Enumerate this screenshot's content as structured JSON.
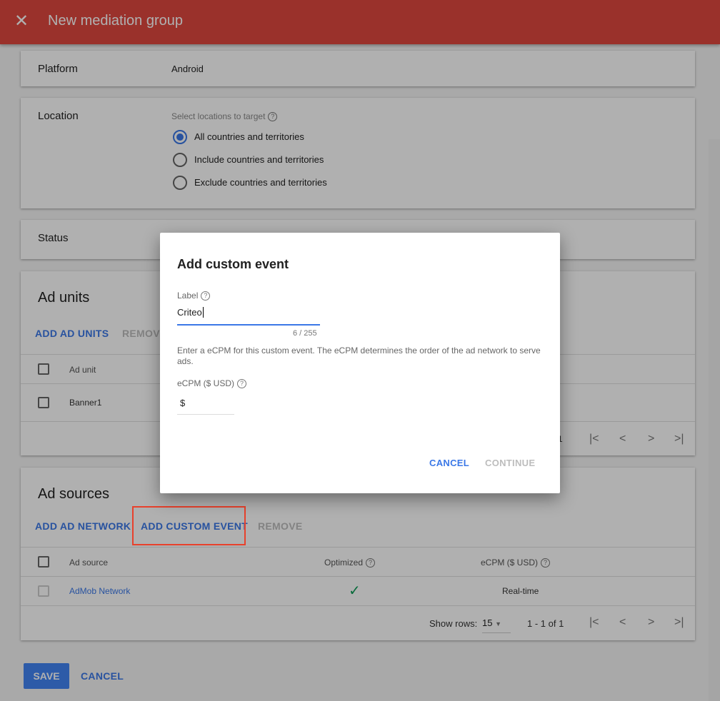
{
  "header": {
    "title": "New mediation group",
    "close_icon": "close-icon"
  },
  "platform": {
    "label": "Platform",
    "value": "Android"
  },
  "location": {
    "label": "Location",
    "hint": "Select locations to target",
    "options": [
      "All countries and territories",
      "Include countries and territories",
      "Exclude countries and territories"
    ],
    "selected": 0
  },
  "status": {
    "label": "Status"
  },
  "ad_units": {
    "title": "Ad units",
    "add_label": "ADD AD UNITS",
    "remove_label": "REMOVE",
    "column": "Ad unit",
    "rows": [
      "Banner1"
    ],
    "page_info": "1"
  },
  "ad_sources": {
    "title": "Ad sources",
    "add_network": "ADD AD NETWORK",
    "add_custom": "ADD CUSTOM EVENT",
    "remove": "REMOVE",
    "columns": [
      "Ad source",
      "Optimized",
      "eCPM ($ USD)"
    ],
    "rows": [
      {
        "source": "AdMob Network",
        "optimized": "✓",
        "ecpm": "Real-time"
      }
    ],
    "show_rows_label": "Show rows:",
    "show_rows_value": "15",
    "page_info": "1 - 1 of 1"
  },
  "footer": {
    "save": "SAVE",
    "cancel": "CANCEL"
  },
  "dialog": {
    "title": "Add custom event",
    "label_field": "Label",
    "label_value": "Criteo",
    "counter": "6 / 255",
    "description": "Enter a eCPM for this custom event. The eCPM determines the order of the ad network to serve ads.",
    "ecpm_label": "eCPM ($ USD)",
    "currency": "$",
    "cancel": "CANCEL",
    "continue": "CONTINUE"
  },
  "colors": {
    "accent": "#3b78e7",
    "header": "#e0483f",
    "highlight": "#e8412c",
    "check": "#0f9d58"
  }
}
